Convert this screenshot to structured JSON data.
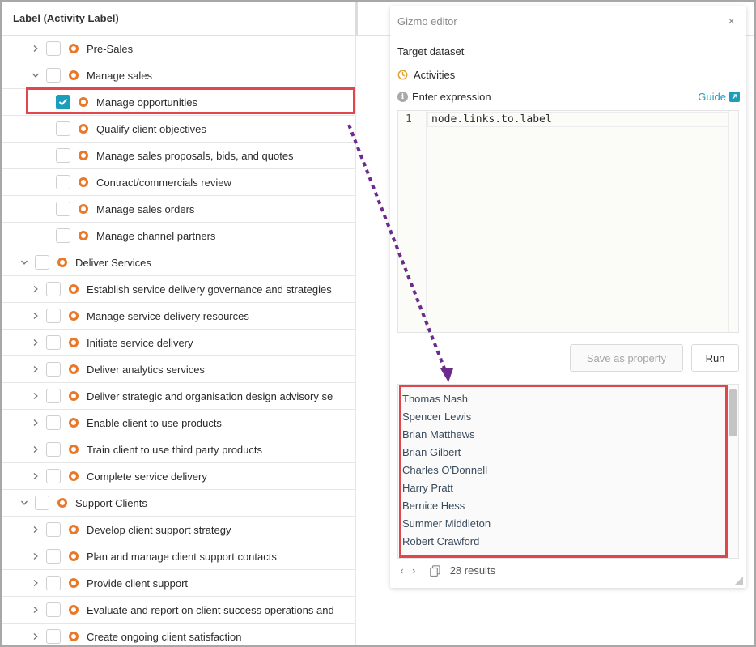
{
  "tree": {
    "header": "Label (Activity Label)",
    "rows": [
      {
        "label": "Pre-Sales",
        "level": 1,
        "chevron": "right",
        "checked": false
      },
      {
        "label": "Manage sales",
        "level": 1,
        "chevron": "down",
        "checked": false
      },
      {
        "label": "Manage opportunities",
        "level": 2,
        "chevron": "none",
        "checked": true
      },
      {
        "label": "Qualify client objectives",
        "level": 2,
        "chevron": "none",
        "checked": false
      },
      {
        "label": "Manage sales proposals, bids, and quotes",
        "level": 2,
        "chevron": "none",
        "checked": false
      },
      {
        "label": "Contract/commercials review",
        "level": 2,
        "chevron": "none",
        "checked": false
      },
      {
        "label": "Manage sales orders",
        "level": 2,
        "chevron": "none",
        "checked": false
      },
      {
        "label": "Manage channel partners",
        "level": 2,
        "chevron": "none",
        "checked": false
      },
      {
        "label": "Deliver Services",
        "level": 0,
        "chevron": "down",
        "checked": false
      },
      {
        "label": "Establish service delivery governance and strategies",
        "level": 1,
        "chevron": "right",
        "checked": false
      },
      {
        "label": "Manage service delivery resources",
        "level": 1,
        "chevron": "right",
        "checked": false
      },
      {
        "label": "Initiate service delivery",
        "level": 1,
        "chevron": "right",
        "checked": false
      },
      {
        "label": "Deliver analytics services",
        "level": 1,
        "chevron": "right",
        "checked": false
      },
      {
        "label": "Deliver strategic and organisation design advisory se",
        "level": 1,
        "chevron": "right",
        "checked": false
      },
      {
        "label": "Enable client to use products",
        "level": 1,
        "chevron": "right",
        "checked": false
      },
      {
        "label": "Train client to use third party products",
        "level": 1,
        "chevron": "right",
        "checked": false
      },
      {
        "label": "Complete service delivery",
        "level": 1,
        "chevron": "right",
        "checked": false
      },
      {
        "label": "Support Clients",
        "level": 0,
        "chevron": "down",
        "checked": false
      },
      {
        "label": "Develop client support strategy",
        "level": 1,
        "chevron": "right",
        "checked": false
      },
      {
        "label": "Plan and manage client support contacts",
        "level": 1,
        "chevron": "right",
        "checked": false
      },
      {
        "label": "Provide client support",
        "level": 1,
        "chevron": "right",
        "checked": false
      },
      {
        "label": "Evaluate and report on client success operations and",
        "level": 1,
        "chevron": "right",
        "checked": false
      },
      {
        "label": "Create ongoing client satisfaction",
        "level": 1,
        "chevron": "right",
        "checked": false
      }
    ]
  },
  "editor": {
    "title": "Gizmo editor",
    "close": "×",
    "target_label": "Target dataset",
    "dataset": "Activities",
    "expression_label": "Enter expression",
    "guide": "Guide",
    "line_number": "1",
    "expression": "node.links.to.label",
    "save_button": "Save as property",
    "run_button": "Run",
    "results": [
      "Thomas Nash",
      "Spencer Lewis",
      "Brian Matthews",
      "Brian Gilbert",
      "Charles O'Donnell",
      "Harry Pratt",
      "Bernice Hess",
      "Summer Middleton",
      "Robert Crawford"
    ],
    "result_count": "28 results"
  },
  "colors": {
    "accent": "#1b9dbb",
    "node_ring": "#e8782a",
    "annotation_box": "#e0474c",
    "annotation_arrow": "#6b2a8c"
  },
  "icons": {
    "expand": "chevron-right-icon",
    "collapse": "chevron-down-icon",
    "node": "ring-icon",
    "dataset": "clock-icon",
    "info": "info-icon",
    "external": "external-link-icon",
    "code": "code-braces-icon",
    "copy": "copy-icon",
    "resize": "resize-handle-icon"
  }
}
